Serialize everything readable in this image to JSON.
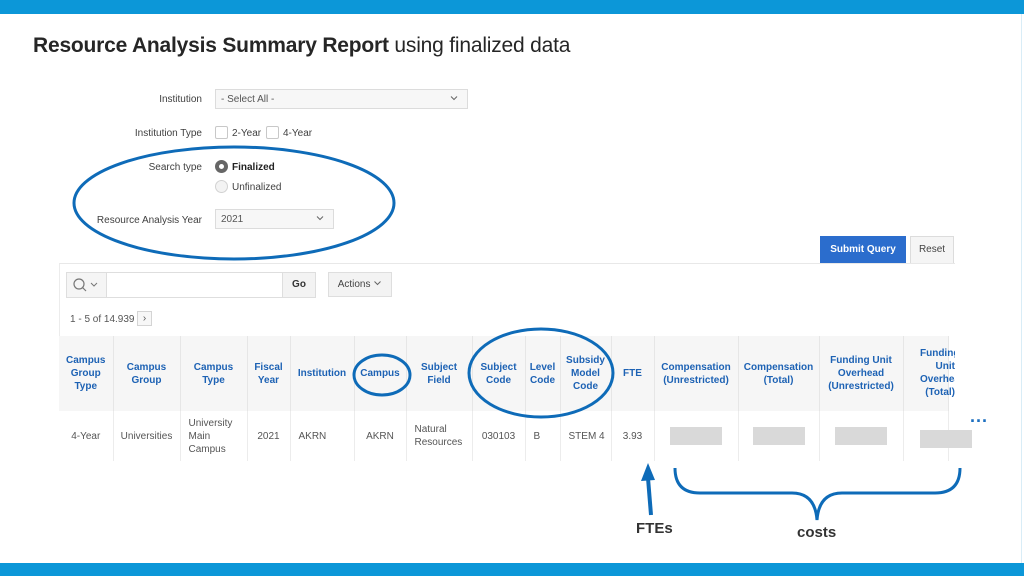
{
  "slide": {
    "title_bold": "Resource Analysis Summary Report",
    "title_rest": " using finalized data"
  },
  "form": {
    "institution": {
      "label": "Institution",
      "value": "- Select All -"
    },
    "institution_type": {
      "label": "Institution Type",
      "options": [
        {
          "label": "2-Year",
          "checked": false
        },
        {
          "label": "4-Year",
          "checked": false
        }
      ]
    },
    "search_type": {
      "label": "Search type",
      "options": [
        {
          "label": "Finalized",
          "selected": true
        },
        {
          "label": "Unfinalized",
          "selected": false
        }
      ]
    },
    "year": {
      "label": "Resource Analysis Year",
      "value": "2021"
    },
    "submit_label": "Submit Query",
    "reset_label": "Reset"
  },
  "report": {
    "search_placeholder": "",
    "go_label": "Go",
    "actions_label": "Actions",
    "pagination": "1 - 5 of 14.939",
    "next_glyph": "›",
    "columns": [
      "Campus Group Type",
      "Campus Group",
      "Campus Type",
      "Fiscal Year",
      "Institution",
      "Campus",
      "Subject Field",
      "Subject Code",
      "Level Code",
      "Subsidy Model Code",
      "FTE",
      "Compensation (Unrestricted)",
      "Compensation (Total)",
      "Funding Unit Overhead (Unrestricted)",
      "Funding Unit Overhead (Total)"
    ],
    "rows": [
      {
        "campus_group_type": "4-Year",
        "campus_group": "Universities",
        "campus_type": "University Main Campus",
        "fiscal_year": "2021",
        "institution": "AKRN",
        "campus": "AKRN",
        "subject_field": "Natural Resources",
        "subject_code": "030103",
        "level_code": "B",
        "subsidy_model_code": "STEM 4",
        "fte": "3.93",
        "compensation_unrestricted": "[redacted]",
        "compensation_total": "[redacted]",
        "funding_overhead_unrestricted": "[redacted]",
        "funding_overhead_total": "[redacted]"
      }
    ],
    "more_columns_indicator": "..."
  },
  "annotations": {
    "fte_label": "FTEs",
    "costs_label": "costs",
    "color": "#0e6bb8"
  }
}
